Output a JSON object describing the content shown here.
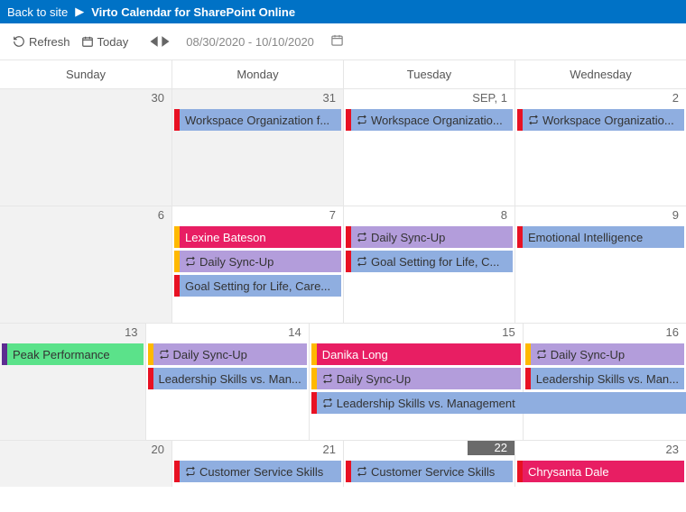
{
  "topbar": {
    "back": "Back to site",
    "title": "Virto Calendar for SharePoint Online"
  },
  "toolbar": {
    "refresh": "Refresh",
    "today": "Today",
    "range": "08/30/2020 - 10/10/2020"
  },
  "headers": [
    "Sunday",
    "Monday",
    "Tuesday",
    "Wednesday"
  ],
  "weeks": [
    {
      "days": [
        {
          "num": "30",
          "shaded": true,
          "events": []
        },
        {
          "num": "31",
          "shaded": true,
          "events": [
            {
              "stripe": "s-red",
              "bg": "bg-blue",
              "label": "Workspace Organization f...",
              "repeat": false
            }
          ]
        },
        {
          "num": "SEP, 1",
          "events": [
            {
              "stripe": "s-red",
              "bg": "bg-blue",
              "label": "Workspace Organizatio...",
              "repeat": true
            }
          ]
        },
        {
          "num": "2",
          "events": [
            {
              "stripe": "s-red",
              "bg": "bg-blue",
              "label": "Workspace Organizatio...",
              "repeat": true
            }
          ]
        }
      ]
    },
    {
      "days": [
        {
          "num": "6",
          "shaded": true,
          "events": []
        },
        {
          "num": "7",
          "events": [
            {
              "stripe": "s-orange",
              "bg": "bg-pink",
              "label": "Lexine Bateson",
              "repeat": false,
              "white": true
            },
            {
              "stripe": "s-orange",
              "bg": "bg-purple",
              "label": "Daily Sync-Up",
              "repeat": true
            },
            {
              "stripe": "s-red",
              "bg": "bg-blue",
              "label": "Goal Setting for Life, Care...",
              "repeat": false
            }
          ]
        },
        {
          "num": "8",
          "events": [
            {
              "stripe": "s-red",
              "bg": "bg-purple",
              "label": "Daily Sync-Up",
              "repeat": true
            },
            {
              "stripe": "s-red",
              "bg": "bg-blue",
              "label": "Goal Setting for Life, C...",
              "repeat": true
            }
          ]
        },
        {
          "num": "9",
          "events": [
            {
              "stripe": "s-red",
              "bg": "bg-blue",
              "label": "Emotional Intelligence",
              "repeat": false
            }
          ]
        }
      ]
    },
    {
      "days": [
        {
          "num": "13",
          "shaded": true,
          "events": [
            {
              "stripe": "s-purple",
              "bg": "bg-green",
              "label": "Peak Performance",
              "repeat": false
            }
          ]
        },
        {
          "num": "14",
          "events": [
            {
              "stripe": "s-orange",
              "bg": "bg-purple",
              "label": "Daily Sync-Up",
              "repeat": true
            },
            {
              "stripe": "s-red",
              "bg": "bg-blue",
              "label": "Leadership Skills vs. Man...",
              "repeat": false
            }
          ]
        },
        {
          "num": "15",
          "events": [
            {
              "stripe": "s-orange",
              "bg": "bg-pink",
              "label": "Danika Long",
              "repeat": false,
              "white": true
            },
            {
              "stripe": "s-orange",
              "bg": "bg-purple",
              "label": "Daily Sync-Up",
              "repeat": true
            },
            {
              "stripe": "s-red",
              "bg": "bg-blue",
              "label": "Leadership Skills vs. Management",
              "repeat": true,
              "span2": true
            }
          ]
        },
        {
          "num": "16",
          "events": [
            {
              "stripe": "s-orange",
              "bg": "bg-purple",
              "label": "Daily Sync-Up",
              "repeat": true
            },
            {
              "stripe": "s-red",
              "bg": "bg-blue",
              "label": "Leadership Skills vs. Man...",
              "repeat": false
            }
          ]
        }
      ]
    },
    {
      "short": true,
      "days": [
        {
          "num": "20",
          "shaded": true,
          "events": []
        },
        {
          "num": "21",
          "events": [
            {
              "stripe": "s-red",
              "bg": "bg-blue",
              "label": "Customer Service Skills",
              "repeat": true
            }
          ]
        },
        {
          "num": "22",
          "today": true,
          "events": [
            {
              "stripe": "s-red",
              "bg": "bg-blue",
              "label": "Customer Service Skills",
              "repeat": true
            }
          ]
        },
        {
          "num": "23",
          "events": [
            {
              "stripe": "s-red",
              "bg": "bg-pink",
              "label": "Chrysanta Dale",
              "repeat": false,
              "white": true
            }
          ]
        }
      ]
    }
  ]
}
